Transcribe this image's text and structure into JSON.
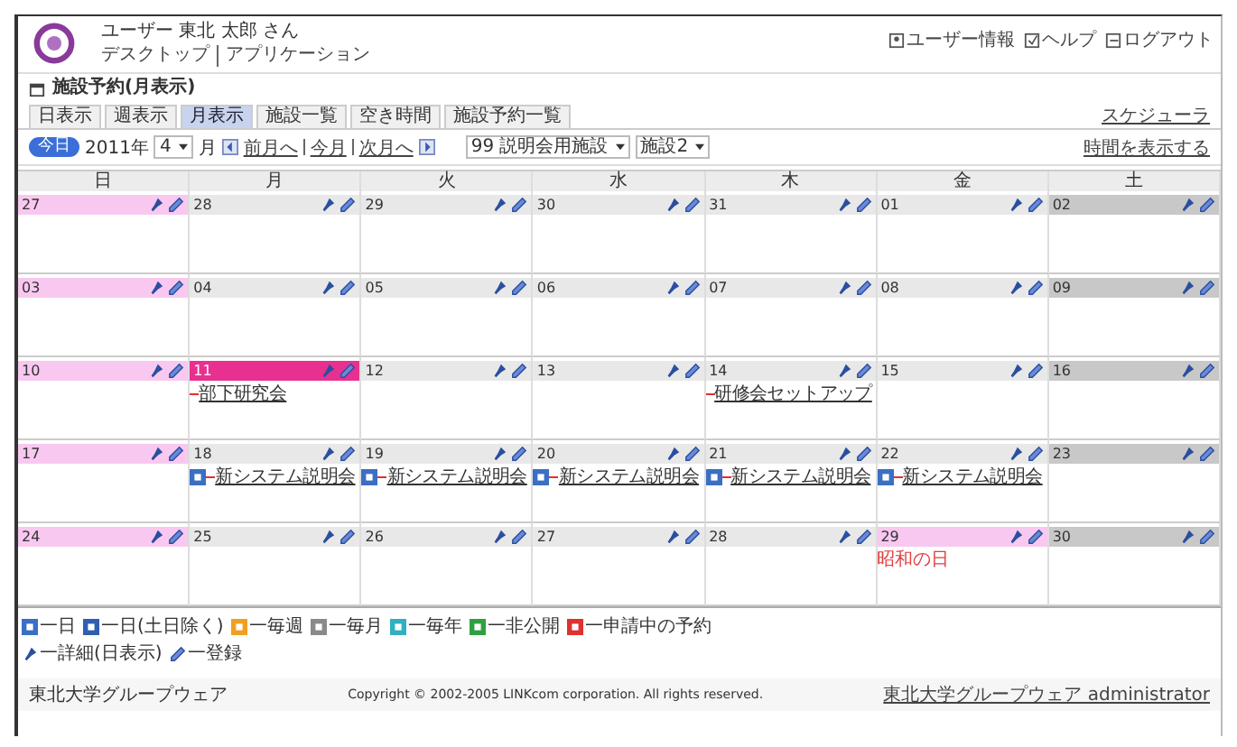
{
  "header": {
    "user": "ユーザー 東北 太郎 さん",
    "nav": [
      "デスクトップ",
      "アプリケーション"
    ],
    "links": [
      {
        "label": "ユーザー情報"
      },
      {
        "label": "ヘルプ"
      },
      {
        "label": "ログアウト"
      }
    ]
  },
  "page_title": "施設予約(月表示)",
  "tabs": [
    {
      "label": "日表示",
      "selected": false
    },
    {
      "label": "週表示",
      "selected": false
    },
    {
      "label": "月表示",
      "selected": true
    },
    {
      "label": "施設一覧",
      "selected": false
    },
    {
      "label": "空き時間",
      "selected": false
    },
    {
      "label": "施設予約一覧",
      "selected": false
    }
  ],
  "scheduler_link": "スケジューラ",
  "toolbar": {
    "today_button": "今日",
    "year": "2011年",
    "month": "4",
    "month_unit": "月",
    "prev": "前月へ",
    "current": "今月",
    "next": "次月へ",
    "facility_group": "99 説明会用施設",
    "facility": "施設2",
    "show_time_link": "時間を表示する"
  },
  "weekdays": [
    "日",
    "月",
    "火",
    "水",
    "木",
    "金",
    "土"
  ],
  "weeks": [
    {
      "days": [
        {
          "date": "27",
          "kind": "sunday"
        },
        {
          "date": "28",
          "kind": "weekday"
        },
        {
          "date": "29",
          "kind": "weekday"
        },
        {
          "date": "30",
          "kind": "weekday"
        },
        {
          "date": "31",
          "kind": "weekday"
        },
        {
          "date": "01",
          "kind": "weekday"
        },
        {
          "date": "02",
          "kind": "saturday"
        }
      ]
    },
    {
      "days": [
        {
          "date": "03",
          "kind": "sunday"
        },
        {
          "date": "04",
          "kind": "weekday"
        },
        {
          "date": "05",
          "kind": "weekday"
        },
        {
          "date": "06",
          "kind": "weekday"
        },
        {
          "date": "07",
          "kind": "weekday"
        },
        {
          "date": "08",
          "kind": "weekday"
        },
        {
          "date": "09",
          "kind": "saturday"
        }
      ]
    },
    {
      "days": [
        {
          "date": "10",
          "kind": "sunday"
        },
        {
          "date": "11",
          "kind": "today",
          "events": [
            {
              "title": "部下研究会"
            }
          ]
        },
        {
          "date": "12",
          "kind": "weekday"
        },
        {
          "date": "13",
          "kind": "weekday"
        },
        {
          "date": "14",
          "kind": "weekday",
          "events": [
            {
              "title": "研修会セットアップ"
            }
          ]
        },
        {
          "date": "15",
          "kind": "weekday"
        },
        {
          "date": "16",
          "kind": "saturday"
        }
      ]
    },
    {
      "days": [
        {
          "date": "17",
          "kind": "sunday"
        },
        {
          "date": "18",
          "kind": "weekday",
          "events": [
            {
              "title": "新システム説明会",
              "color": "#3a6fc4"
            }
          ]
        },
        {
          "date": "19",
          "kind": "weekday",
          "events": [
            {
              "title": "新システム説明会",
              "color": "#3a6fc4"
            }
          ]
        },
        {
          "date": "20",
          "kind": "weekday",
          "events": [
            {
              "title": "新システム説明会",
              "color": "#3a6fc4"
            }
          ]
        },
        {
          "date": "21",
          "kind": "weekday",
          "events": [
            {
              "title": "新システム説明会",
              "color": "#3a6fc4"
            }
          ]
        },
        {
          "date": "22",
          "kind": "weekday",
          "events": [
            {
              "title": "新システム説明会",
              "color": "#3a6fc4"
            }
          ]
        },
        {
          "date": "23",
          "kind": "saturday"
        }
      ]
    },
    {
      "days": [
        {
          "date": "24",
          "kind": "sunday"
        },
        {
          "date": "25",
          "kind": "weekday"
        },
        {
          "date": "26",
          "kind": "weekday"
        },
        {
          "date": "27",
          "kind": "weekday"
        },
        {
          "date": "28",
          "kind": "weekday"
        },
        {
          "date": "29",
          "kind": "holiday",
          "holiday_name": "昭和の日"
        },
        {
          "date": "30",
          "kind": "saturday"
        }
      ]
    }
  ],
  "legend": [
    {
      "label": "一日",
      "color": "#3a6fc4"
    },
    {
      "label": "一日(土日除く)",
      "color": "#2f5fb0"
    },
    {
      "label": "一毎週",
      "color": "#f0a020"
    },
    {
      "label": "一毎月",
      "color": "#8a8a8a"
    },
    {
      "label": "一毎年",
      "color": "#30b0c0"
    },
    {
      "label": "一非公開",
      "color": "#30a040"
    },
    {
      "label": "一申請中の予約",
      "color": "#e03030"
    }
  ],
  "legend_icons": [
    {
      "kind": "pin",
      "label": "一詳細(日表示)"
    },
    {
      "kind": "pen",
      "label": "一登録"
    }
  ],
  "footer": {
    "site": "東北大学グループウェア",
    "copyright": "Copyright © 2002-2005 LINKcom corporation. All rights reserved.",
    "admin_link": "東北大学グループウェア administrator"
  }
}
